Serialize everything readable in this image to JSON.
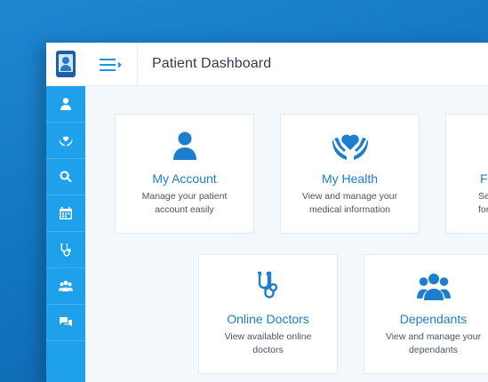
{
  "header": {
    "title": "Patient Dashboard"
  },
  "cards": [
    {
      "title": "My Account",
      "description": "Manage your patient\naccount easily",
      "icon": "user-icon"
    },
    {
      "title": "My Health",
      "description": "View and manage your\nmedical information",
      "icon": "heart-hands-icon"
    },
    {
      "title": "Fi",
      "description": "Se\nfor y",
      "icon": ""
    },
    {
      "title": "Online Doctors",
      "description": "View available online\ndoctors",
      "icon": "stethoscope-icon"
    },
    {
      "title": "Dependants",
      "description": "View and manage your\ndependants",
      "icon": "group-icon"
    }
  ],
  "sidebar": {
    "items": [
      {
        "icon": "user-icon"
      },
      {
        "icon": "heart-hands-icon"
      },
      {
        "icon": "search-icon"
      },
      {
        "icon": "calendar-icon"
      },
      {
        "icon": "stethoscope-icon"
      },
      {
        "icon": "group-icon"
      },
      {
        "icon": "chat-icon"
      }
    ]
  },
  "colors": {
    "accent": "#1ea0ea",
    "brand": "#1d7ed0",
    "background": "#1173bd"
  }
}
